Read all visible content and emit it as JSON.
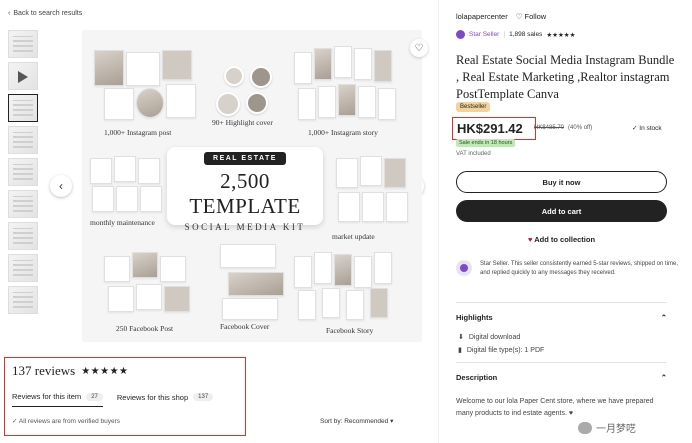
{
  "nav": {
    "back_label": "Back to search results"
  },
  "listing": {
    "caps": {
      "instagram_post": "1,000+ Instagram post",
      "highlight_cover": "90+ Highlight cover",
      "instagram_story": "1,000+ Instagram story",
      "monthly_maintenance": "monthly maintenance",
      "market_update": "market update",
      "facebook_post": "250 Facebook Post",
      "facebook_cover": "Facebook Cover",
      "facebook_story": "Facebook Story"
    },
    "kit": {
      "tag": "REAL ESTATE",
      "big": "2,500 TEMPLATE",
      "sub": "SOCIAL MEDIA KIT"
    }
  },
  "reviews": {
    "title": "137 reviews",
    "stars": "★★★★★",
    "tab_item": "Reviews for this item",
    "tab_item_count": "27",
    "tab_shop": "Reviews for this shop",
    "tab_shop_count": "137",
    "verified": "All reviews are from verified buyers",
    "sort": "Sort by: Recommended"
  },
  "seller": {
    "shop_name": "lolapapercenter",
    "follow": "Follow",
    "star_seller": "Star Seller",
    "sales": "1,898 sales",
    "stars": "★★★★★"
  },
  "product": {
    "title": "Real Estate Social Media Instagram Bundle , Real Estate Marketing ,Realtor instagram PostTemplate Canva",
    "bestseller": "Bestseller",
    "price": "HK$291.42",
    "old_price": "HK$485.70",
    "discount": "(40% off)",
    "in_stock": "In stock",
    "sale_ends": "Sale ends in 18 hours",
    "vat": "VAT included"
  },
  "actions": {
    "buy_now": "Buy it now",
    "add_to_cart": "Add to cart",
    "add_to_collection": "Add to collection"
  },
  "star_note": "Star Seller. This seller consistently earned 5-star reviews, shipped on time, and replied quickly to any messages they received.",
  "highlights": {
    "title": "Highlights",
    "items": [
      "Digital download",
      "Digital file type(s): 1 PDF"
    ]
  },
  "description": {
    "title": "Description",
    "text": "Welcome to our lola Paper Cent store, where we have prepared many products to ind estate agents. ♥"
  },
  "watermark": "一月梦呓"
}
